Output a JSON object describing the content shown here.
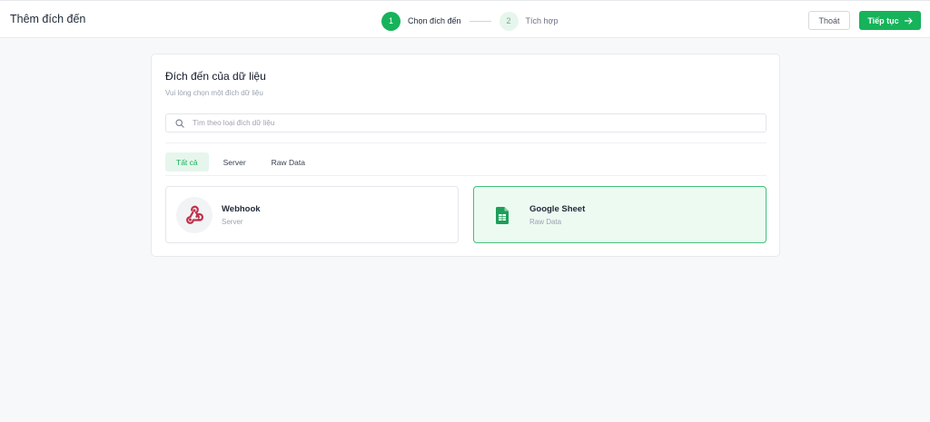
{
  "header": {
    "title": "Thêm đích đến",
    "steps": [
      {
        "number": "1",
        "label": "Chọn đích đến",
        "state": "active"
      },
      {
        "number": "2",
        "label": "Tích hợp",
        "state": "inactive"
      }
    ],
    "exit_label": "Thoát",
    "next_label": "Tiếp tục",
    "next_icon": "arrow-right-icon"
  },
  "panel": {
    "title": "Đích đến của dữ liệu",
    "subtitle": "Vui lòng chọn một đích dữ liệu",
    "search": {
      "placeholder": "Tìm theo loại đích dữ liệu",
      "value": "",
      "icon": "search-icon"
    },
    "tabs": [
      {
        "label": "Tất cả",
        "active": true
      },
      {
        "label": "Server",
        "active": false
      },
      {
        "label": "Raw Data",
        "active": false
      }
    ],
    "destinations": [
      {
        "name": "Webhook",
        "category": "Server",
        "icon": "webhook-icon",
        "selected": false
      },
      {
        "name": "Google Sheet",
        "category": "Raw Data",
        "icon": "google-sheets-icon",
        "selected": true
      }
    ]
  },
  "colors": {
    "accent": "#16b35a",
    "accent_light": "#e6f6ec",
    "selected_card_bg": "#ecfaf2",
    "webhook_red": "#c0314b",
    "sheets_green": "#1e9e5a"
  }
}
